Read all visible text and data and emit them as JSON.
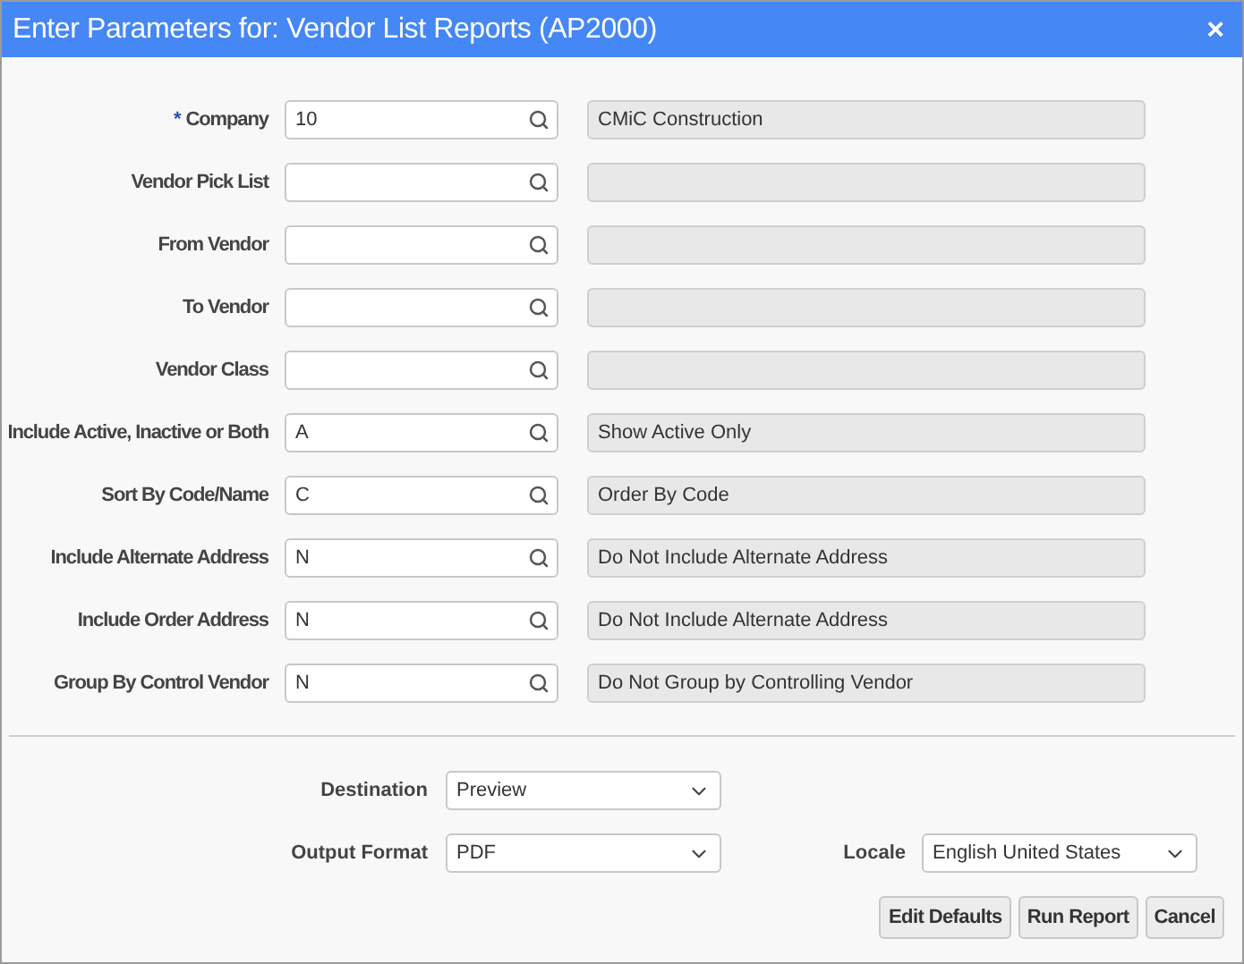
{
  "window": {
    "title": "Enter Parameters for: Vendor List Reports (AP2000)",
    "close": "×"
  },
  "parameters": [
    {
      "marker": "*",
      "label": "Company",
      "value": "10",
      "description": "CMiC Construction"
    },
    {
      "label": "Vendor Pick List"
    },
    {
      "label": "From Vendor"
    },
    {
      "label": "To Vendor"
    },
    {
      "label": "Vendor Class"
    },
    {
      "label": "Include Active, Inactive or Both",
      "value": "A",
      "description": "Show Active Only"
    },
    {
      "label": "Sort By Code/Name",
      "value": "C",
      "description": "Order By Code"
    },
    {
      "label": "Include Alternate Address",
      "value": "N",
      "description": "Do Not Include Alternate Address"
    },
    {
      "label": "Include Order Address",
      "value": "N",
      "description": "Do Not Include Alternate Address"
    },
    {
      "label": "Group By Control Vendor",
      "value": "N",
      "description": "Do Not Group by Controlling Vendor"
    }
  ],
  "output": {
    "destination": {
      "label": "Destination",
      "value": "Preview"
    },
    "format": {
      "label": "Output Format",
      "value": "PDF"
    },
    "locale": {
      "label": "Locale",
      "value": "English United States"
    }
  },
  "buttons": [
    "Edit Defaults",
    "Run Report",
    "Cancel"
  ]
}
